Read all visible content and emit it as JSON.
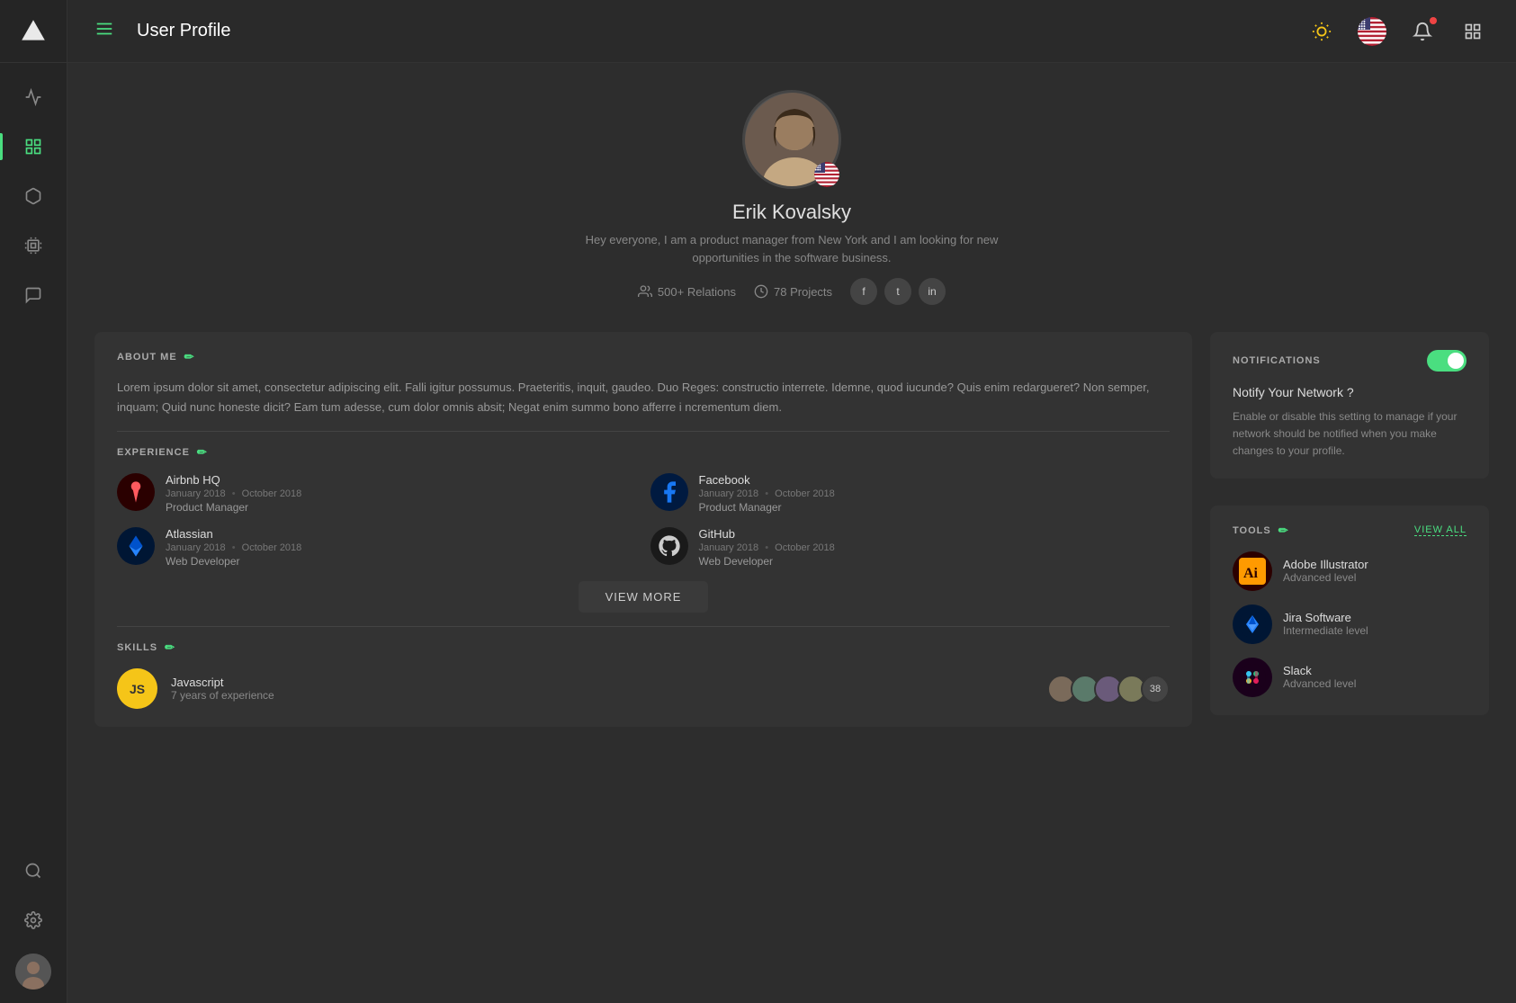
{
  "app": {
    "logo_alt": "App Logo",
    "title": "User Profile"
  },
  "sidebar": {
    "items": [
      {
        "name": "dashboard",
        "icon": "▲",
        "label": "Home",
        "active": false
      },
      {
        "name": "activity",
        "icon": "⚡",
        "label": "Activity",
        "active": false
      },
      {
        "name": "grid",
        "icon": "⊞",
        "label": "Grid",
        "active": true
      },
      {
        "name": "cube",
        "icon": "◻",
        "label": "Cube",
        "active": false
      },
      {
        "name": "chip",
        "icon": "◈",
        "label": "Chip",
        "active": false
      },
      {
        "name": "chat",
        "icon": "◯",
        "label": "Chat",
        "active": false
      }
    ],
    "bottom": [
      {
        "name": "search",
        "icon": "⌕",
        "label": "Search"
      },
      {
        "name": "settings",
        "icon": "⚙",
        "label": "Settings"
      }
    ]
  },
  "header": {
    "menu_label": "☰",
    "title": "User Profile",
    "icons": {
      "brightness": "☀",
      "flag_alt": "US Flag",
      "notification": "🔔",
      "grid": "⊞"
    }
  },
  "profile": {
    "name": "Erik Kovalsky",
    "bio": "Hey everyone,  I am a product manager from New York and I am looking for new opportunities in the software business.",
    "relations": "500+ Relations",
    "projects": "78 Projects",
    "socials": [
      "f",
      "t",
      "in"
    ]
  },
  "about": {
    "title": "ABOUT ME",
    "text": "Lorem ipsum dolor sit amet, consectetur adipiscing elit. Falli igitur possumus. Praeteritis, inquit, gaudeo. Duo Reges: constructio interrete. Idemne, quod iucunde? Quis enim redargueret? Non semper, inquam; Quid nunc honeste dicit? Eam tum adesse, cum dolor omnis absit; Negat enim summo bono afferre i ncrementum diem."
  },
  "experience": {
    "title": "EXPERIENCE",
    "items": [
      {
        "name": "Airbnb HQ",
        "date_start": "January 2018",
        "date_end": "October 2018",
        "role": "Product Manager",
        "color": "#ff5a5f",
        "logo_text": "A"
      },
      {
        "name": "Facebook",
        "date_start": "January 2018",
        "date_end": "October 2018",
        "role": "Product Manager",
        "color": "#1877f2",
        "logo_text": "f"
      },
      {
        "name": "Atlassian",
        "date_start": "January 2018",
        "date_end": "October 2018",
        "role": "Web Developer",
        "color": "#0052cc",
        "logo_text": "A"
      },
      {
        "name": "GitHub",
        "date_start": "January 2018",
        "date_end": "October 2018",
        "role": "Web Developer",
        "color": "#333",
        "logo_text": "G"
      }
    ],
    "view_more": "VIEW MORE"
  },
  "skills": {
    "title": "SKILLS",
    "items": [
      {
        "name": "Javascript",
        "abbr": "JS",
        "years": "7 years of experience",
        "badge_bg": "#f5c518",
        "badge_color": "#333",
        "endorsers_count": "38"
      }
    ]
  },
  "notifications": {
    "title": "NOTIFICATIONS",
    "subtitle": "Notify Your Network ?",
    "description": "Enable or disable this setting to manage if your network should be notified when you make changes to your profile.",
    "enabled": true
  },
  "tools": {
    "title": "TOOLS",
    "view_all": "VIEW ALL",
    "items": [
      {
        "name": "Adobe Illustrator",
        "level": "Advanced level",
        "color": "#FF9A00",
        "bg": "#2b0000",
        "abbr": "Ai"
      },
      {
        "name": "Jira Software",
        "level": "Intermediate level",
        "color": "#2684ff",
        "bg": "#001634",
        "abbr": "J"
      },
      {
        "name": "Slack",
        "level": "Advanced level",
        "color": "#4a154b",
        "bg": "#1a001b",
        "abbr": "S"
      }
    ]
  }
}
